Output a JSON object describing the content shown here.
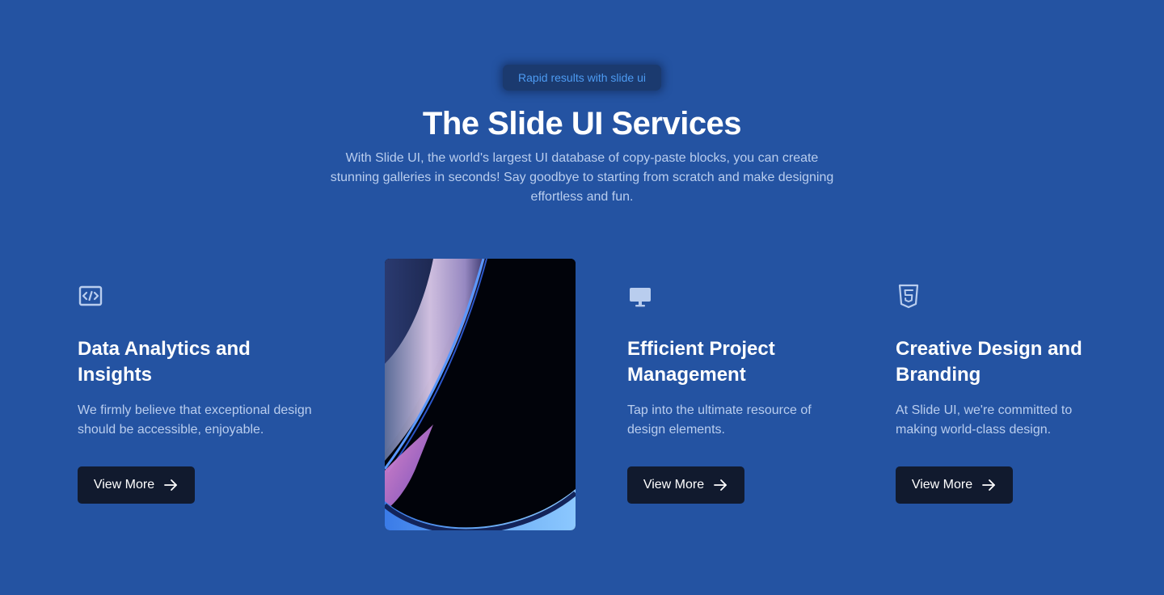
{
  "header": {
    "badge": "Rapid results with slide ui",
    "title": "The Slide UI Services",
    "subtitle": "With Slide UI, the world's largest UI database of copy-paste blocks, you can create stunning galleries in seconds! Say goodbye to starting from scratch and make designing effortless and fun."
  },
  "colors": {
    "background": "#2453a2",
    "badge_text": "#4d9bf2",
    "button_bg": "#111a2e",
    "icon": "#b9cdee"
  },
  "services": [
    {
      "icon": "code-icon",
      "title": "Data Analytics and Insights",
      "description": "We firmly believe that exceptional design should be accessible, enjoyable.",
      "button_label": "View More"
    },
    {
      "icon": "monitor-icon",
      "title": "Efficient Project Management",
      "description": "Tap into the ultimate resource of design elements.",
      "button_label": "View More"
    },
    {
      "icon": "html5-icon",
      "title": "Creative Design and Branding",
      "description": "At Slide UI, we're committed to making world-class design.",
      "button_label": "View More"
    }
  ]
}
